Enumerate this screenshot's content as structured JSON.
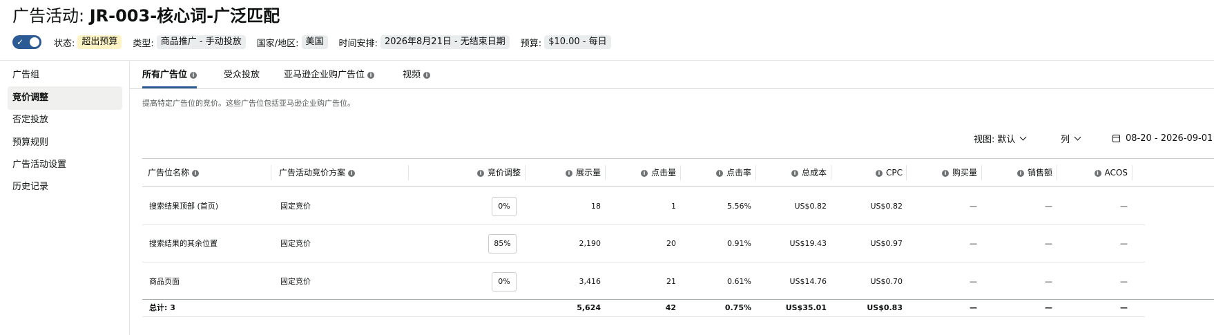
{
  "header": {
    "title_prefix": "广告活动: ",
    "title_name": "JR-003-核心词-广泛匹配",
    "toggle_check": "✓",
    "status_label": "状态:",
    "status_value": "超出预算",
    "type_label": "类型:",
    "type_value": "商品推广 - 手动投放",
    "country_label": "国家/地区:",
    "country_value": "美国",
    "schedule_label": "时间安排:",
    "schedule_value": "2026年8月21日 - 无结束日期",
    "budget_label": "预算:",
    "budget_value": "$10.00 - 每日"
  },
  "sidebar": {
    "items": [
      {
        "label": "广告组"
      },
      {
        "label": "竞价调整"
      },
      {
        "label": "否定投放"
      },
      {
        "label": "预算规则"
      },
      {
        "label": "广告活动设置"
      },
      {
        "label": "历史记录"
      }
    ]
  },
  "tabs": [
    {
      "label": "所有广告位"
    },
    {
      "label": "受众投放"
    },
    {
      "label": "亚马逊企业购广告位"
    },
    {
      "label": "视频"
    }
  ],
  "info_glyph": "i",
  "description": "提高特定广告位的竞价。这些广告位包括亚马逊企业购广告位。",
  "controls": {
    "view_label": "视图:",
    "view_value": "默认",
    "columns_label": "列",
    "date_range": "08-20 - 2026-09-01"
  },
  "table": {
    "headers": {
      "placement": "广告位名称",
      "strategy": "广告活动竞价方案",
      "bid_adjust": "竞价调整",
      "impressions": "展示量",
      "clicks": "点击量",
      "ctr": "点击率",
      "spend": "总成本",
      "cpc": "CPC",
      "orders": "购买量",
      "sales": "销售额",
      "acos": "ACOS"
    },
    "rows": [
      {
        "placement": "搜索结果顶部 (首页)",
        "strategy": "固定竞价",
        "bid_adjust": "0%",
        "impressions": "18",
        "clicks": "1",
        "ctr": "5.56%",
        "spend": "US$0.82",
        "cpc": "US$0.82",
        "orders": "—",
        "sales": "—",
        "acos": "—"
      },
      {
        "placement": "搜索结果的其余位置",
        "strategy": "固定竞价",
        "bid_adjust": "85%",
        "impressions": "2,190",
        "clicks": "20",
        "ctr": "0.91%",
        "spend": "US$19.43",
        "cpc": "US$0.97",
        "orders": "—",
        "sales": "—",
        "acos": "—"
      },
      {
        "placement": "商品页面",
        "strategy": "固定竞价",
        "bid_adjust": "0%",
        "impressions": "3,416",
        "clicks": "21",
        "ctr": "0.61%",
        "spend": "US$14.76",
        "cpc": "US$0.70",
        "orders": "—",
        "sales": "—",
        "acos": "—"
      }
    ],
    "totals": {
      "label": "总计: 3",
      "impressions": "5,624",
      "clicks": "42",
      "ctr": "0.75%",
      "spend": "US$35.01",
      "cpc": "US$0.83",
      "orders": "—",
      "sales": "—",
      "acos": "—"
    }
  },
  "colors": {
    "accent": "#2b5a95",
    "warn_pill": "#fdf3c4",
    "pill": "#eaeded",
    "active_nav": "#f0f0ee"
  }
}
